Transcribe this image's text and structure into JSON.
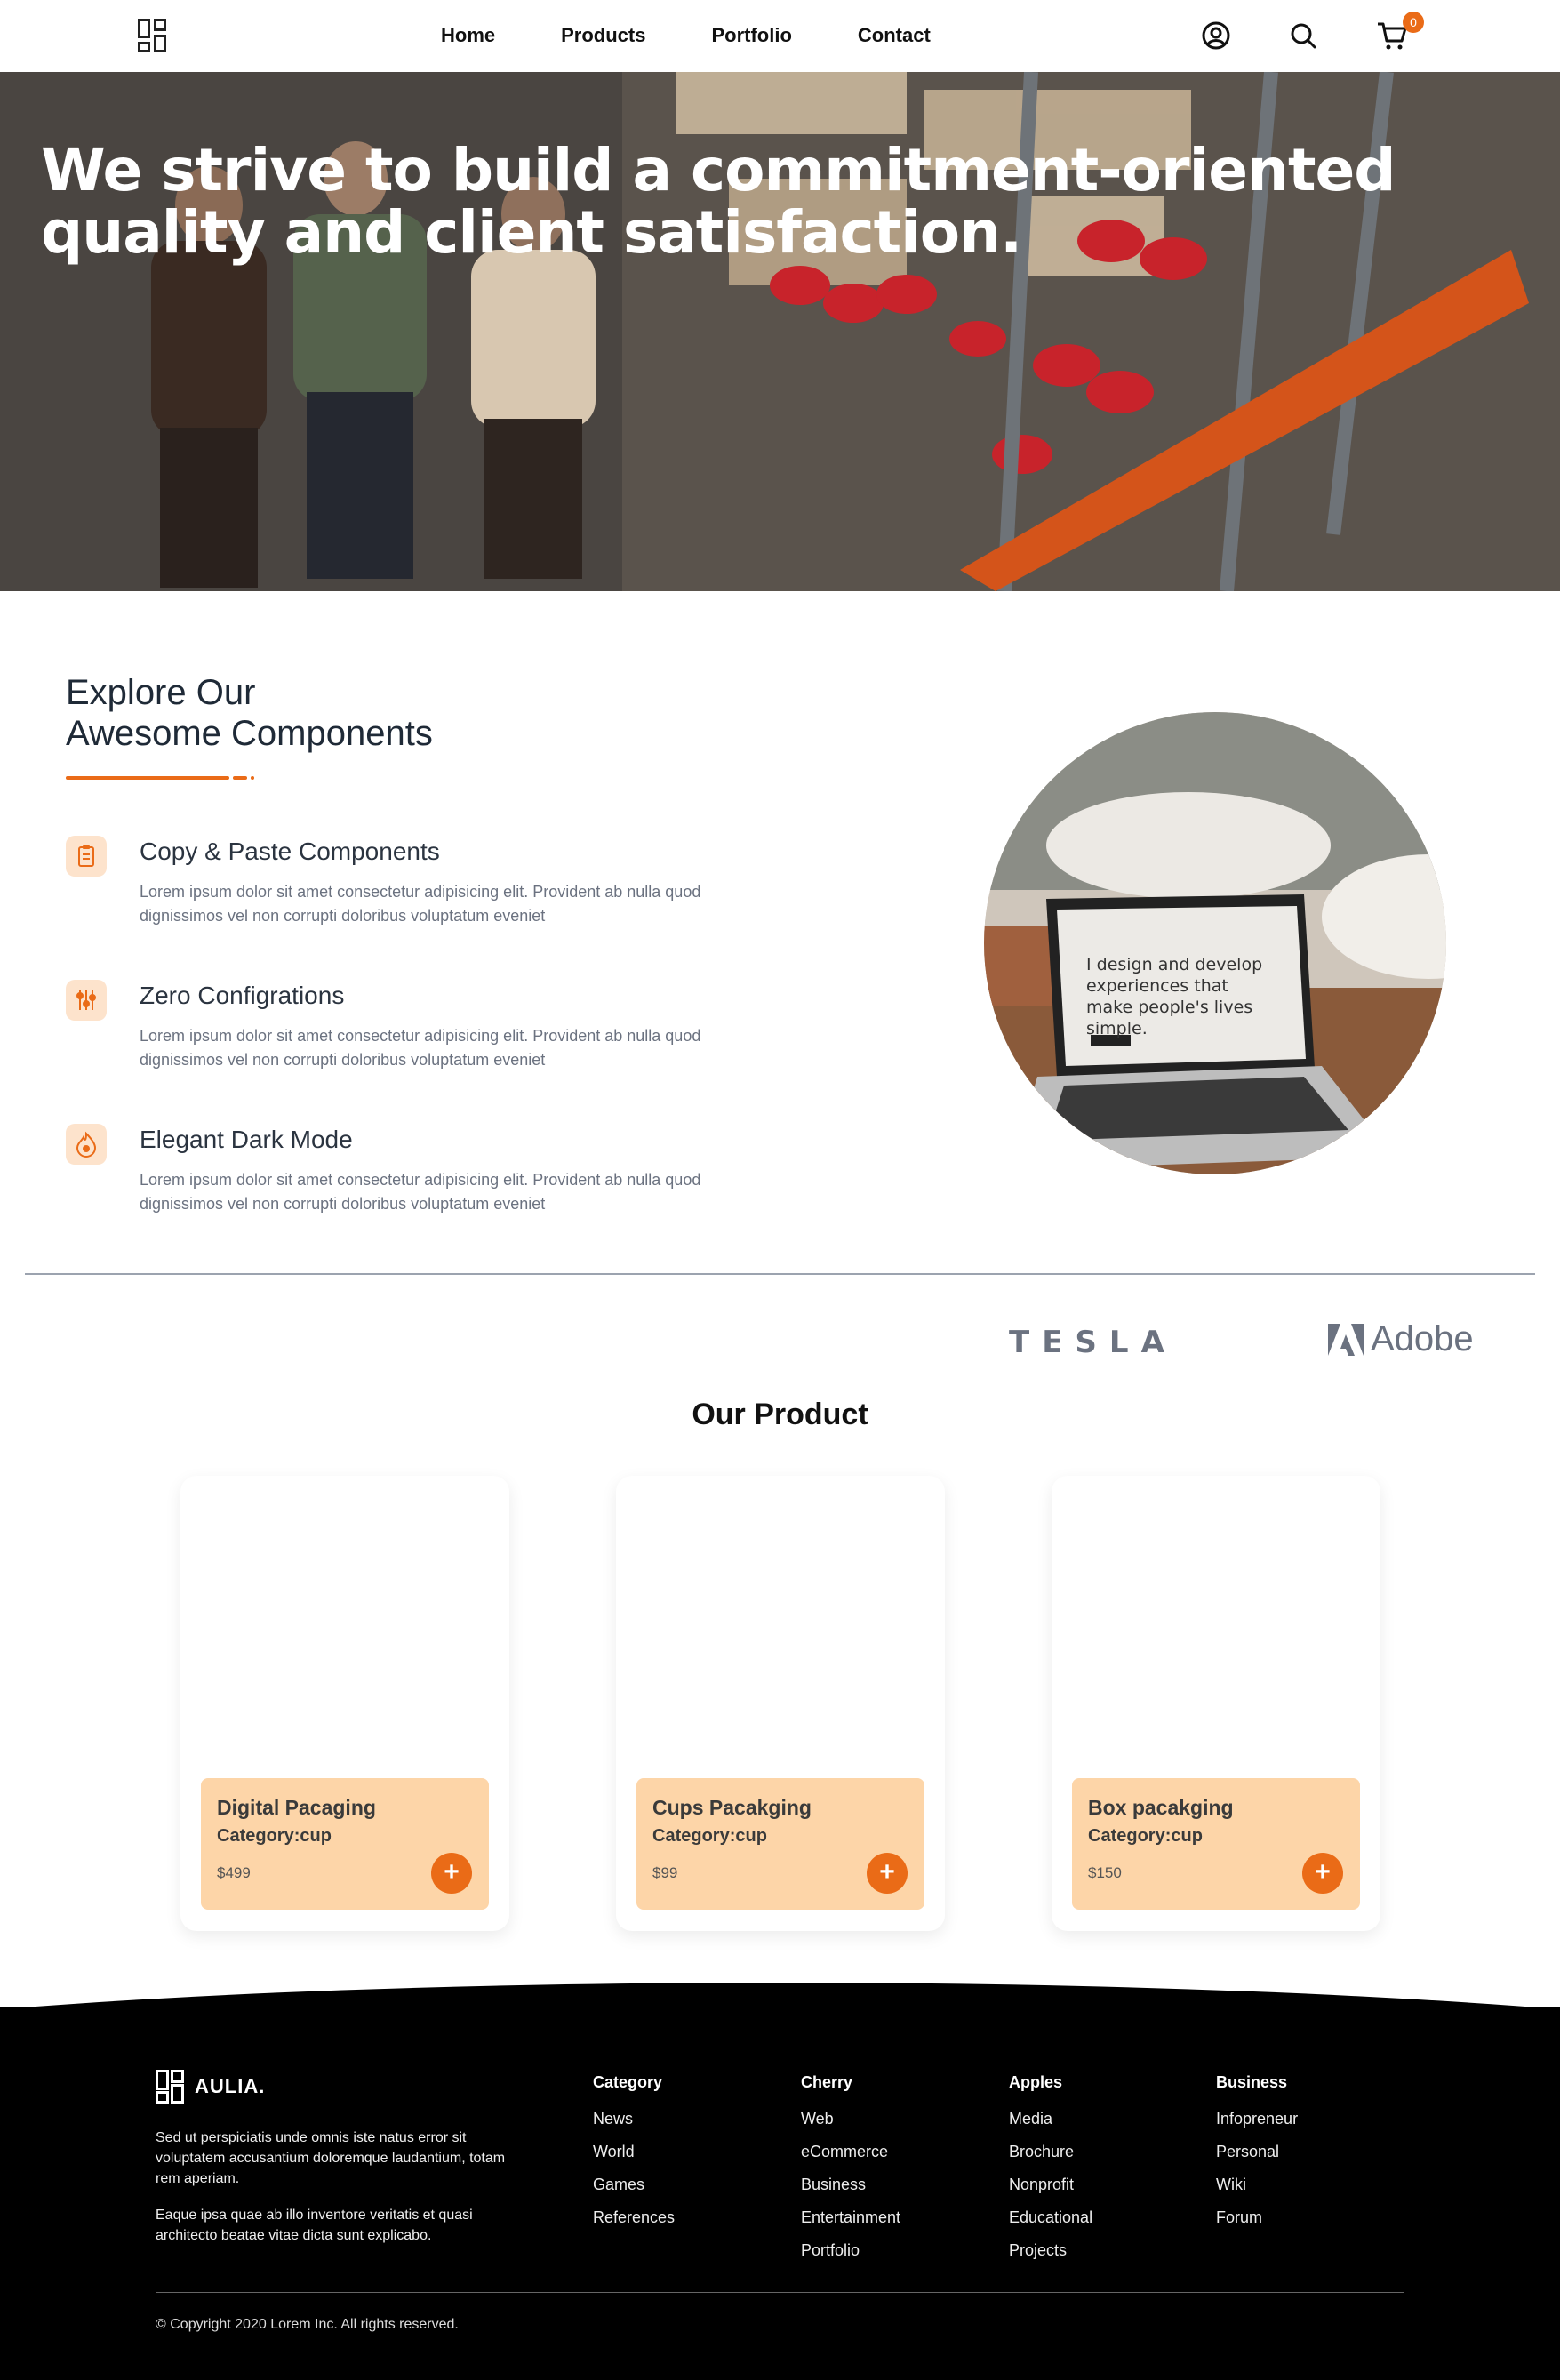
{
  "nav": {
    "links": [
      "Home",
      "Products",
      "Portfolio",
      "Contact"
    ],
    "cart_count": "0",
    "icons": [
      "user-circle-icon",
      "search-icon",
      "cart-icon"
    ]
  },
  "hero": {
    "title": "We strive to build a commitment-oriented quality and client satisfaction."
  },
  "explore": {
    "title_line1": "Explore Our",
    "title_line2": "Awesome Components",
    "features": [
      {
        "icon": "clipboard-icon",
        "title": "Copy & Paste Components",
        "desc": "Lorem ipsum dolor sit amet consectetur adipisicing elit. Provident ab nulla quod dignissimos vel non corrupti doloribus voluptatum eveniet"
      },
      {
        "icon": "sliders-icon",
        "title": "Zero Configrations",
        "desc": "Lorem ipsum dolor sit amet consectetur adipisicing elit. Provident ab nulla quod dignissimos vel non corrupti doloribus voluptatum eveniet"
      },
      {
        "icon": "flame-icon",
        "title": "Elegant Dark Mode",
        "desc": "Lorem ipsum dolor sit amet consectetur adipisicing elit. Provident ab nulla quod dignissimos vel non corrupti doloribus voluptatum eveniet"
      }
    ],
    "laptop_text": "I design and develop experiences that make people's lives simple."
  },
  "brands": {
    "tesla": "TESLA",
    "adobe": "Adobe"
  },
  "products": {
    "heading": "Our Product",
    "items": [
      {
        "name": "Digital Pacaging",
        "category": "Category:cup",
        "price": "$499"
      },
      {
        "name": "Cups Pacakging",
        "category": "Category:cup",
        "price": "$99"
      },
      {
        "name": "Box pacakging",
        "category": "Category:cup",
        "price": "$150"
      }
    ],
    "add_label": "+"
  },
  "footer": {
    "brand": "AULIA.",
    "text1": "Sed ut perspiciatis unde omnis iste natus error sit voluptatem accusantium doloremque laudantium, totam rem aperiam.",
    "text2": "Eaque ipsa quae ab illo inventore veritatis et quasi architecto beatae vitae dicta sunt explicabo.",
    "columns": [
      {
        "title": "Category",
        "items": [
          "News",
          "World",
          "Games",
          "References"
        ]
      },
      {
        "title": "Cherry",
        "items": [
          "Web",
          "eCommerce",
          "Business",
          "Entertainment",
          "Portfolio"
        ]
      },
      {
        "title": "Apples",
        "items": [
          "Media",
          "Brochure",
          "Nonprofit",
          "Educational",
          "Projects"
        ]
      },
      {
        "title": "Business",
        "items": [
          "Infopreneur",
          "Personal",
          "Wiki",
          "Forum"
        ]
      }
    ],
    "copyright": "© Copyright 2020 Lorem Inc. All rights reserved."
  },
  "colors": {
    "accent": "#ea6b17",
    "card_info": "#fdd5a8",
    "icon_bg": "#fde3cc",
    "footer_bg": "#000000"
  }
}
